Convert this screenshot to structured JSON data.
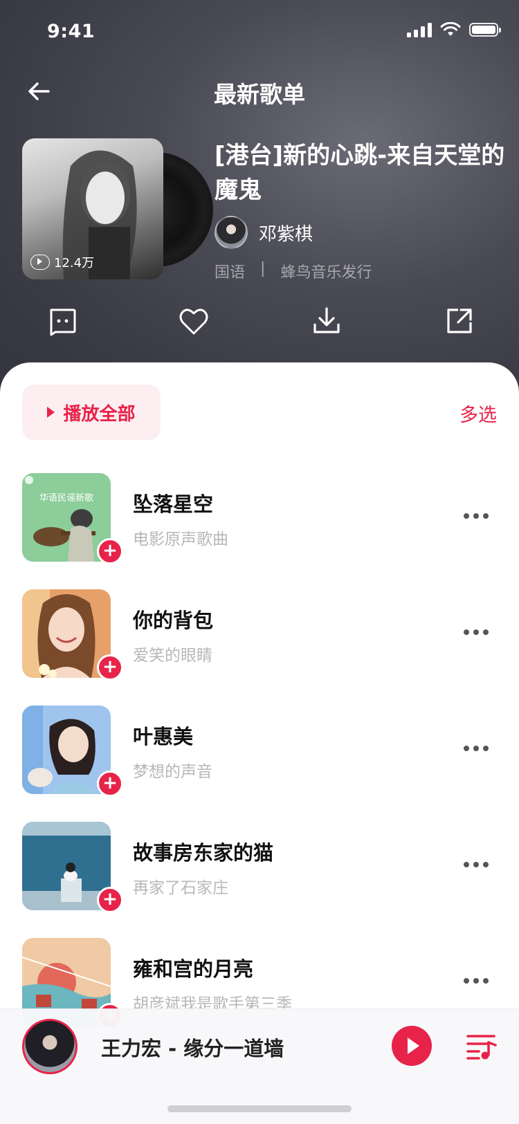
{
  "status_bar": {
    "time": "9:41"
  },
  "nav": {
    "title": "最新歌单"
  },
  "album": {
    "title": "[港台]新的心跳-来自天堂的魔鬼",
    "play_count": "12.4万",
    "artist": "邓紫棋",
    "language": "国语",
    "separator": "|",
    "publisher": "蜂鸟音乐发行"
  },
  "actions": [
    "comment-icon",
    "heart-icon",
    "download-icon",
    "share-icon"
  ],
  "list_header": {
    "play_all": "播放全部",
    "multi_select": "多选"
  },
  "songs": [
    {
      "title": "坠落星空",
      "subtitle": "电影原声歌曲",
      "thumb_caption": "华语民谣新歌"
    },
    {
      "title": "你的背包",
      "subtitle": "爱笑的眼睛"
    },
    {
      "title": "叶惠美",
      "subtitle": "梦想的声音"
    },
    {
      "title": "故事房东家的猫",
      "subtitle": "再家了石家庄"
    },
    {
      "title": "雍和宫的月亮",
      "subtitle": "胡彦斌我是歌手第三季"
    }
  ],
  "player": {
    "now_playing": "王力宏 - 缘分一道墙"
  },
  "colors": {
    "accent": "#e8234a",
    "header": "#3f3f4a"
  }
}
